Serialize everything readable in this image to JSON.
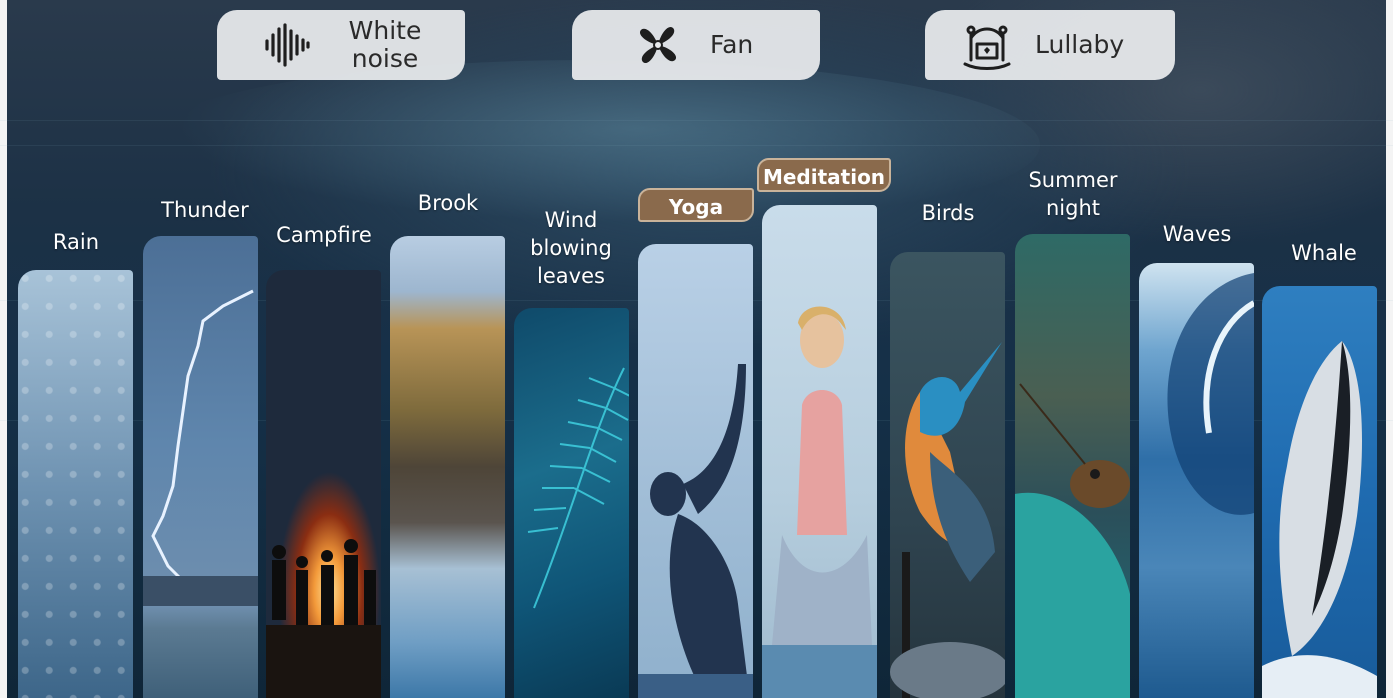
{
  "categories": {
    "white_noise": {
      "label": "White noise",
      "icon": "sound-wave-icon"
    },
    "fan": {
      "label": "Fan",
      "icon": "fan-icon"
    },
    "lullaby": {
      "label": "Lullaby",
      "icon": "cradle-icon"
    }
  },
  "sounds": [
    {
      "name": "Rain"
    },
    {
      "name": "Thunder"
    },
    {
      "name": "Campfire"
    },
    {
      "name": "Brook"
    },
    {
      "name": "Wind blowing leaves"
    },
    {
      "name": "Yoga"
    },
    {
      "name": "Meditation"
    },
    {
      "name": "Birds"
    },
    {
      "name": "Summer night"
    },
    {
      "name": "Waves"
    },
    {
      "name": "Whale"
    }
  ],
  "colors": {
    "pill_bg": "#e8eaec",
    "badge_bg": "#8a6a4c",
    "label_text": "#ffffff"
  }
}
